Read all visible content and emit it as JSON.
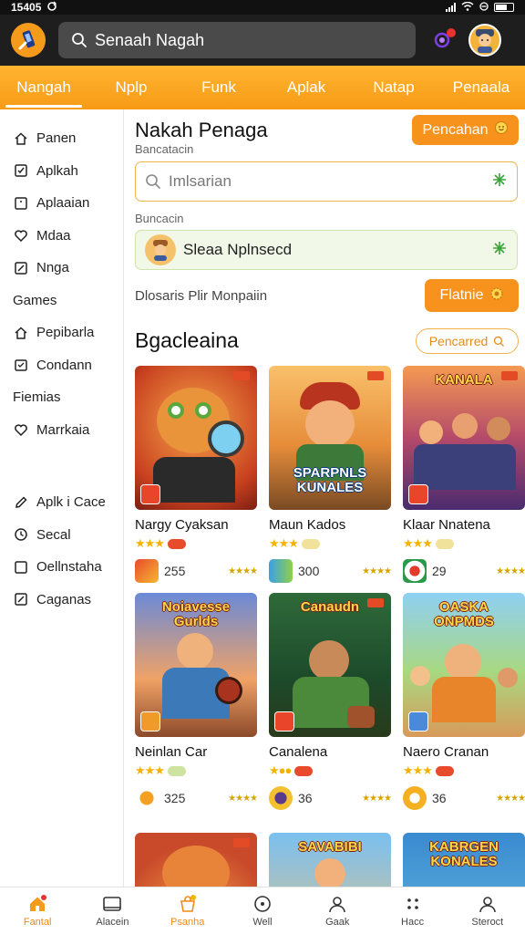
{
  "status_bar": {
    "time": "15405"
  },
  "header": {
    "search_placeholder": "Senaah Nagah"
  },
  "tabs": [
    {
      "label": "Nangah",
      "active": true
    },
    {
      "label": "Nplp"
    },
    {
      "label": "Funk"
    },
    {
      "label": "Aplak"
    },
    {
      "label": "Natap"
    },
    {
      "label": "Penaala"
    }
  ],
  "sidebar": {
    "items_top": [
      {
        "label": "Panen",
        "icon": "home-icon"
      },
      {
        "label": "Aplkah",
        "icon": "check-box-icon"
      },
      {
        "label": "Aplaaian",
        "icon": "square-icon"
      },
      {
        "label": "Mdaa",
        "icon": "heart-icon"
      },
      {
        "label": "Nnga",
        "icon": "edit-box-icon"
      }
    ],
    "heading_games": "Games",
    "items_games": [
      {
        "label": "Pepibarla",
        "icon": "home-icon"
      },
      {
        "label": "Condann",
        "icon": "calendar-icon"
      }
    ],
    "heading_fiemias": "Fiemias",
    "items_fiemias": [
      {
        "label": "Marrkaia",
        "icon": "heart-icon"
      }
    ],
    "items_bottom": [
      {
        "label": "Aplk i Cace",
        "icon": "pen-icon"
      },
      {
        "label": "Secal",
        "icon": "clock-icon"
      },
      {
        "label": "Oellnstaha",
        "icon": "square-icon"
      },
      {
        "label": "Caganas",
        "icon": "edit-box-icon"
      }
    ]
  },
  "main": {
    "title": "Nakah Penaga",
    "title_button": "Pencahan",
    "field1_label": "Bancatacin",
    "field1_placeholder": "Imlsarian",
    "field2_label": "Buncacin",
    "field2_value": "Sleaa Nplnsecd",
    "helper_text": "Dlosaris Plir Monpaiin",
    "helper_button": "Flatnie",
    "section_title": "Bgacleaina",
    "section_button": "Pencarred"
  },
  "cards": [
    {
      "name": "Nargy Cyaksan",
      "count": "255",
      "thumb_text": ""
    },
    {
      "name": "Maun Kados",
      "count": "300",
      "thumb_text": "SPARPNLS KUNALES"
    },
    {
      "name": "Klaar Nnatena",
      "count": "29",
      "thumb_text": "KANALA"
    },
    {
      "name": "Neinlan Car",
      "count": "325",
      "thumb_text": "Noiavesse Gurlds"
    },
    {
      "name": "Canalena",
      "count": "36",
      "thumb_text": "Canaudn"
    },
    {
      "name": "Naero Cranan",
      "count": "36",
      "thumb_text": "OASKA ONPMDS"
    },
    {
      "name": "",
      "count": "",
      "thumb_text": ""
    },
    {
      "name": "",
      "count": "",
      "thumb_text": "SAVABIBI"
    },
    {
      "name": "",
      "count": "",
      "thumb_text": "KABRGEN KONALES"
    }
  ],
  "bottom_nav": [
    {
      "label": "Fantal",
      "icon": "home-icon",
      "active": true
    },
    {
      "label": "Alacein",
      "icon": "tablet-icon"
    },
    {
      "label": "Psanha",
      "icon": "bag-icon",
      "active": true
    },
    {
      "label": "Well",
      "icon": "compass-icon"
    },
    {
      "label": "Gaak",
      "icon": "user-icon"
    },
    {
      "label": "Hacc",
      "icon": "grid-dots-icon"
    },
    {
      "label": "Steroct",
      "icon": "profile-icon"
    }
  ],
  "colors": {
    "accent": "#f7921d",
    "header": "#1e1e1e",
    "input_border": "#f2b44c",
    "filled_bg": "#f1f8e7"
  }
}
